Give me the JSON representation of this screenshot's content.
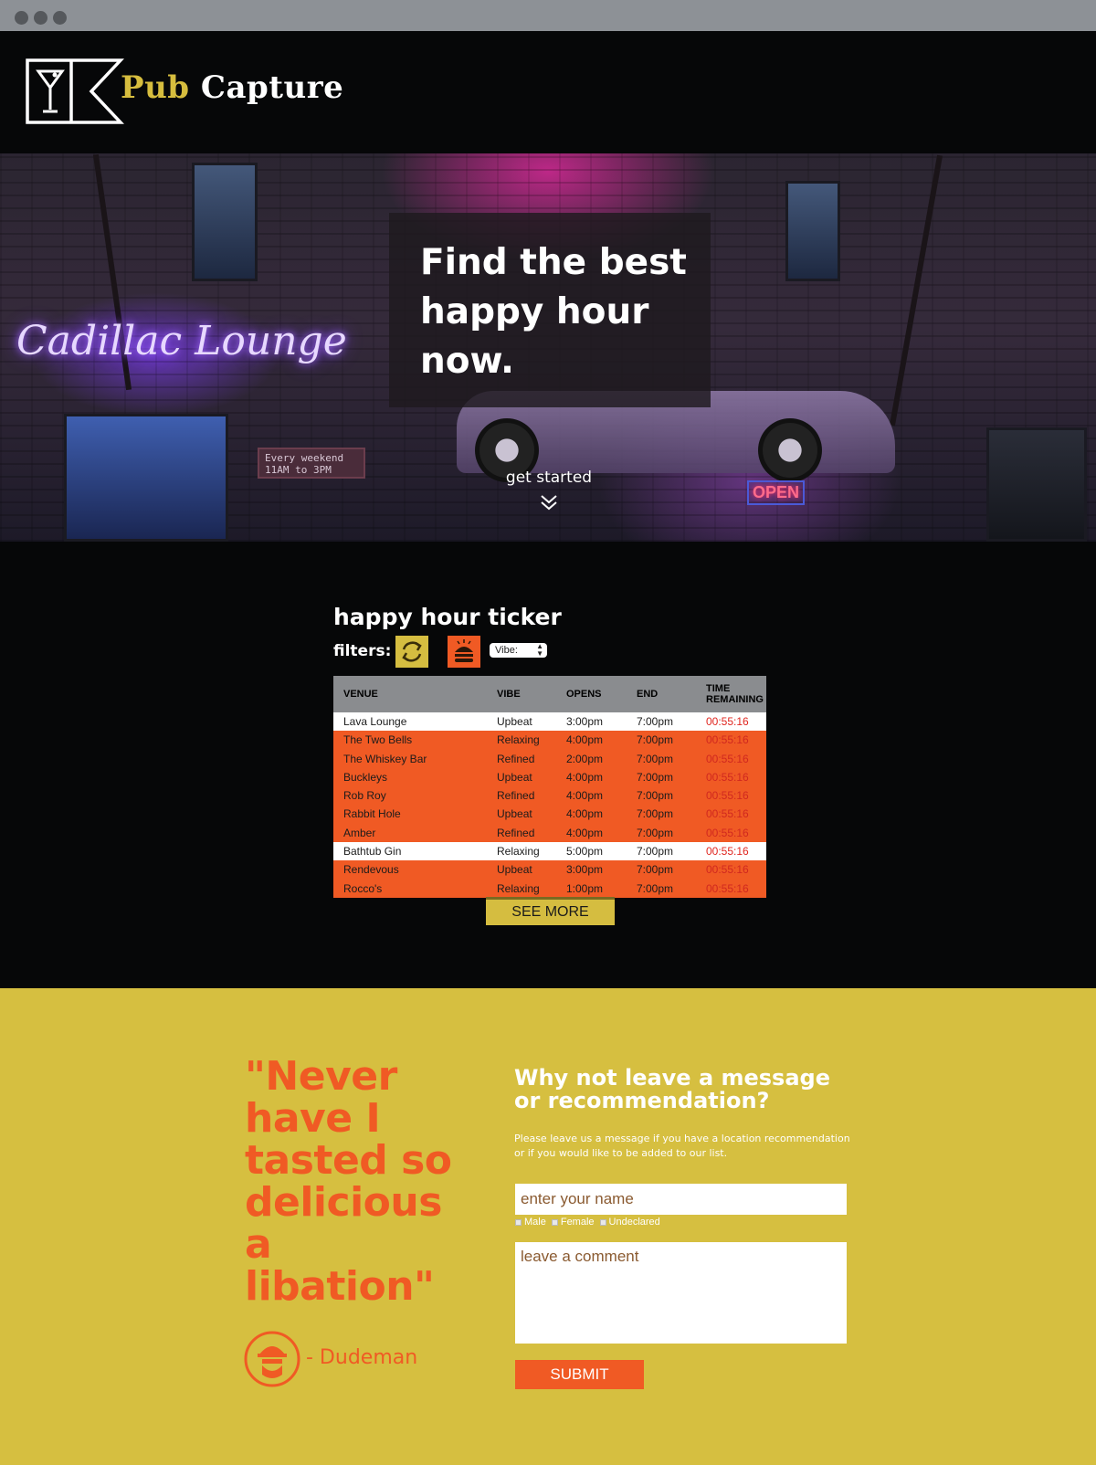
{
  "header": {
    "brand_first": "Pub",
    "brand_second": "Capture",
    "logo_icon": "martini-glass-icon"
  },
  "hero": {
    "title": "Find the best happy hour now.",
    "cta": "get started",
    "cta_icon": "double-chevron-down-icon",
    "neon_sign": "Cadillac Lounge",
    "small_sign": "Every weekend 11AM to 3PM",
    "open_sign": "OPEN"
  },
  "ticker": {
    "title": "happy hour ticker",
    "filters_label": "filters:",
    "filter_icons": [
      "refresh-icon",
      "burger-icon"
    ],
    "vibe_select": "Vibe:",
    "columns": [
      "VENUE",
      "VIBE",
      "OPENS",
      "END",
      "TIME REMAINING"
    ],
    "rows": [
      {
        "venue": "Lava Lounge",
        "vibe": "Upbeat",
        "opens": "3:00pm",
        "end": "7:00pm",
        "remaining": "00:55:16",
        "highlight": "white"
      },
      {
        "venue": "The Two Bells",
        "vibe": "Relaxing",
        "opens": "4:00pm",
        "end": "7:00pm",
        "remaining": "00:55:16",
        "highlight": "orange"
      },
      {
        "venue": "The Whiskey Bar",
        "vibe": "Refined",
        "opens": "2:00pm",
        "end": "7:00pm",
        "remaining": "00:55:16",
        "highlight": "orange"
      },
      {
        "venue": "Buckleys",
        "vibe": "Upbeat",
        "opens": "4:00pm",
        "end": "7:00pm",
        "remaining": "00:55:16",
        "highlight": "orange"
      },
      {
        "venue": "Rob Roy",
        "vibe": "Refined",
        "opens": "4:00pm",
        "end": "7:00pm",
        "remaining": "00:55:16",
        "highlight": "orange"
      },
      {
        "venue": "Rabbit Hole",
        "vibe": "Upbeat",
        "opens": "4:00pm",
        "end": "7:00pm",
        "remaining": "00:55:16",
        "highlight": "orange"
      },
      {
        "venue": "Amber",
        "vibe": "Refined",
        "opens": "4:00pm",
        "end": "7:00pm",
        "remaining": "00:55:16",
        "highlight": "orange"
      },
      {
        "venue": "Bathtub Gin",
        "vibe": "Relaxing",
        "opens": "5:00pm",
        "end": "7:00pm",
        "remaining": "00:55:16",
        "highlight": "white"
      },
      {
        "venue": "Rendevous",
        "vibe": "Upbeat",
        "opens": "3:00pm",
        "end": "7:00pm",
        "remaining": "00:55:16",
        "highlight": "orange"
      },
      {
        "venue": "Rocco's",
        "vibe": "Relaxing",
        "opens": "1:00pm",
        "end": "7:00pm",
        "remaining": "00:55:16",
        "highlight": "orange"
      }
    ],
    "see_more": "SEE MORE"
  },
  "testimonial": {
    "quote": "\"Never have I tasted so delicious a libation\"",
    "author": "- Dudeman",
    "avatar_icon": "dude-avatar-icon"
  },
  "form": {
    "title": "Why not leave a message or recommendation?",
    "description": "Please leave us a message if you have a location recommendation or if you would like to be added to our list.",
    "name_placeholder": "enter your name",
    "genders": [
      "Male",
      "Female",
      "Undeclared"
    ],
    "comment_placeholder": "leave a comment",
    "submit": "SUBMIT"
  },
  "colors": {
    "orange": "#f05a24",
    "mustard": "#d6bf40",
    "black": "#060708",
    "gray_header": "#8a8c8f"
  }
}
